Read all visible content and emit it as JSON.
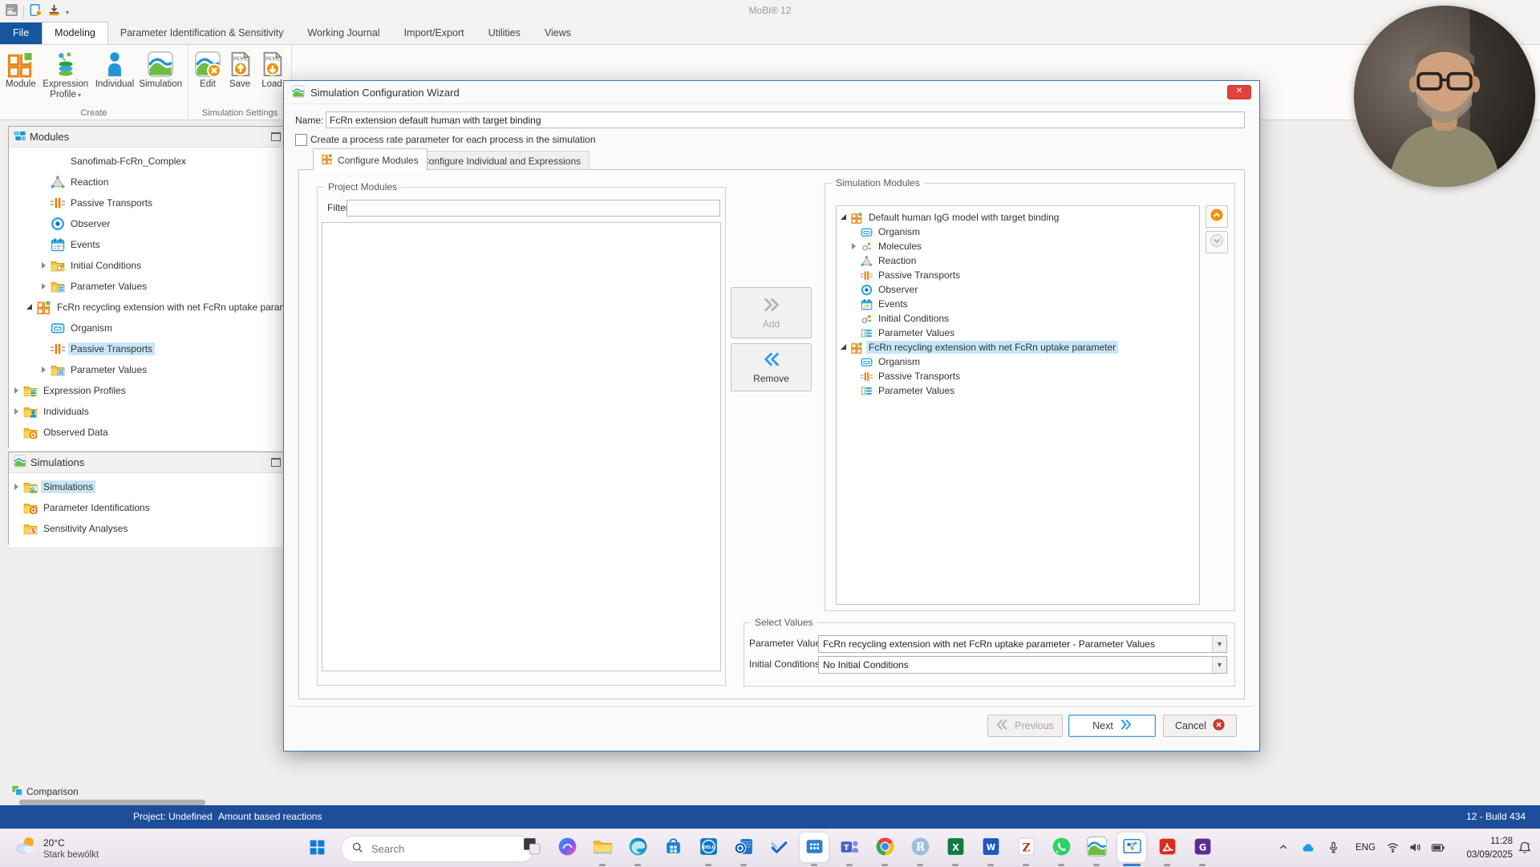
{
  "window": {
    "title": "MoBi® 12"
  },
  "ribbon": {
    "tabs": [
      "File",
      "Modeling",
      "Parameter Identification & Sensitivity",
      "Working Journal",
      "Import/Export",
      "Utilities",
      "Views"
    ],
    "active_tab": "Modeling",
    "groups": [
      {
        "label": "Create",
        "buttons": [
          {
            "label": "Module",
            "icon": "module"
          },
          {
            "label": "Expression Profile",
            "icon": "expression-profile",
            "dropdown": true
          },
          {
            "label": "Individual",
            "icon": "individual"
          },
          {
            "label": "Simulation",
            "icon": "sim-wave"
          }
        ]
      },
      {
        "label": "Simulation Settings",
        "buttons": [
          {
            "label": "Edit",
            "icon": "edit"
          },
          {
            "label": "Save",
            "icon": "pkml-save"
          },
          {
            "label": "Load",
            "icon": "pkml-load"
          }
        ]
      }
    ]
  },
  "modules_panel": {
    "title": "Modules",
    "tree": [
      {
        "label": "Sanofimab-FcRn_Complex",
        "icon": "",
        "indent": 2,
        "exp": ""
      },
      {
        "label": "Reaction",
        "icon": "reaction",
        "indent": 2,
        "exp": ""
      },
      {
        "label": "Passive Transports",
        "icon": "passive-transports",
        "indent": 2,
        "exp": ""
      },
      {
        "label": "Observer",
        "icon": "observer",
        "indent": 2,
        "exp": ""
      },
      {
        "label": "Events",
        "icon": "events",
        "indent": 2,
        "exp": ""
      },
      {
        "label": "Initial Conditions",
        "icon": "folder-initial-conditions",
        "indent": 2,
        "exp": "c"
      },
      {
        "label": "Parameter Values",
        "icon": "folder-parameter-values",
        "indent": 2,
        "exp": "c"
      },
      {
        "label": "FcRn recycling extension with net FcRn uptake parameter",
        "icon": "module",
        "indent": 1,
        "exp": "e"
      },
      {
        "label": "Organism",
        "icon": "organism",
        "indent": 2,
        "exp": ""
      },
      {
        "label": "Passive Transports",
        "icon": "passive-transports",
        "indent": 2,
        "exp": "",
        "selected": true
      },
      {
        "label": "Parameter Values",
        "icon": "folder-parameter-values",
        "indent": 2,
        "exp": "c"
      },
      {
        "label": "Expression Profiles",
        "icon": "folder-expression-profiles",
        "indent": 0,
        "exp": "c"
      },
      {
        "label": "Individuals",
        "icon": "folder-individuals",
        "indent": 0,
        "exp": "c"
      },
      {
        "label": "Observed Data",
        "icon": "folder-observed-data",
        "indent": 0,
        "exp": ""
      }
    ]
  },
  "simulations_panel": {
    "title": "Simulations",
    "tree": [
      {
        "label": "Simulations",
        "icon": "folder-simulations",
        "indent": 0,
        "exp": "c",
        "selected": true
      },
      {
        "label": "Parameter Identifications",
        "icon": "folder-param-ident",
        "indent": 0,
        "exp": ""
      },
      {
        "label": "Sensitivity Analyses",
        "icon": "folder-sensitivity",
        "indent": 0,
        "exp": ""
      }
    ]
  },
  "comparison_tab": {
    "label": "Comparison"
  },
  "dialog": {
    "title": "Simulation Configuration Wizard",
    "name_label": "Name:",
    "name_value": "FcRn extension default human with target binding",
    "checkbox_label": "Create a process rate parameter for each process in the simulation",
    "tab_modules": "Configure Modules",
    "tab_individual": "Configure Individual and Expressions",
    "project_modules_legend": "Project Modules",
    "filter_label": "Filter",
    "add_label": "Add",
    "remove_label": "Remove",
    "simulation_modules_legend": "Simulation Modules",
    "sim_tree": [
      {
        "label": "Default human IgG model with target binding",
        "icon": "module",
        "indent": 0,
        "exp": "e"
      },
      {
        "label": "Organism",
        "icon": "organism",
        "indent": 1,
        "exp": ""
      },
      {
        "label": "Molecules",
        "icon": "molecules",
        "indent": 1,
        "exp": "c"
      },
      {
        "label": "Reaction",
        "icon": "reaction",
        "indent": 1,
        "exp": ""
      },
      {
        "label": "Passive Transports",
        "icon": "passive-transports",
        "indent": 1,
        "exp": ""
      },
      {
        "label": "Observer",
        "icon": "observer",
        "indent": 1,
        "exp": ""
      },
      {
        "label": "Events",
        "icon": "events",
        "indent": 1,
        "exp": ""
      },
      {
        "label": "Initial Conditions",
        "icon": "initial-conditions",
        "indent": 1,
        "exp": ""
      },
      {
        "label": "Parameter Values",
        "icon": "parameter-values",
        "indent": 1,
        "exp": ""
      },
      {
        "label": "FcRn recycling extension with net FcRn uptake parameter",
        "icon": "module",
        "indent": 0,
        "exp": "e",
        "selected": true
      },
      {
        "label": "Organism",
        "icon": "organism",
        "indent": 1,
        "exp": ""
      },
      {
        "label": "Passive Transports",
        "icon": "passive-transports",
        "indent": 1,
        "exp": ""
      },
      {
        "label": "Parameter Values",
        "icon": "parameter-values",
        "indent": 1,
        "exp": ""
      }
    ],
    "select_values_legend": "Select Values",
    "param_values_label": "Parameter Values",
    "param_values_value": "FcRn recycling extension with net FcRn uptake parameter - Parameter Values",
    "initial_conditions_label": "Initial Conditions",
    "initial_conditions_value": "No Initial Conditions",
    "previous_label": "Previous",
    "next_label": "Next",
    "cancel_label": "Cancel"
  },
  "statusbar": {
    "project": "Project: Undefined",
    "mode": "Amount based reactions",
    "build": "12 - Build 434"
  },
  "taskbar": {
    "weather_temp": "20°C",
    "weather_desc": "Stark bewölkt",
    "search_placeholder": "Search",
    "apps": [
      {
        "name": "photos",
        "icon": "app-dark"
      },
      {
        "name": "copilot",
        "icon": "copilot"
      },
      {
        "name": "file-explorer",
        "icon": "explorer",
        "running": true
      },
      {
        "name": "edge",
        "icon": "edge",
        "running": true
      },
      {
        "name": "microsoft-store",
        "icon": "store"
      },
      {
        "name": "dell",
        "icon": "dell",
        "running": true
      },
      {
        "name": "outlook",
        "icon": "outlook",
        "running": true
      },
      {
        "name": "todo",
        "icon": "todo"
      },
      {
        "name": "dots-app",
        "icon": "dots-grid",
        "open": true,
        "running": true
      },
      {
        "name": "teams",
        "icon": "teams",
        "running": true
      },
      {
        "name": "chrome",
        "icon": "chrome",
        "running": true
      },
      {
        "name": "r",
        "icon": "r-app",
        "running": true
      },
      {
        "name": "excel",
        "icon": "excel",
        "running": true
      },
      {
        "name": "word",
        "icon": "word",
        "running": true
      },
      {
        "name": "zotero",
        "icon": "zotero",
        "running": true
      },
      {
        "name": "whatsapp",
        "icon": "whatsapp",
        "running": true
      },
      {
        "name": "mobi",
        "icon": "mobi",
        "running": true
      },
      {
        "name": "mobi-active",
        "icon": "active-app",
        "active": true
      },
      {
        "name": "acrobat",
        "icon": "acrobat",
        "running": true
      },
      {
        "name": "g-app",
        "icon": "g-app",
        "running": true
      }
    ],
    "tray_lang": "ENG",
    "time": "11:28",
    "date": "03/09/2025"
  }
}
